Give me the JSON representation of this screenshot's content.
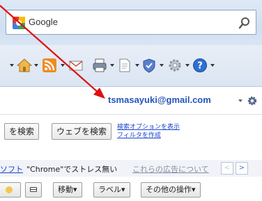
{
  "browser": {
    "search_provider": "Google",
    "icons": [
      "google-provider-icon",
      "search-icon",
      "home-icon",
      "feed-icon",
      "mail-icon",
      "print-icon",
      "page-icon",
      "safety-icon",
      "tools-icon",
      "help-icon"
    ]
  },
  "gmail": {
    "account_email": "tsmasayuki@gmail.com",
    "buttons": {
      "search_mail": "を検索",
      "search_web": "ウェブを検索"
    },
    "links": {
      "search_options": "検索オプションを表示",
      "create_filter": "フィルタを作成"
    },
    "ad": {
      "source": "ソフト",
      "text": "\"Chrome\"でストレス無い",
      "about_ads": "これらの広告について"
    },
    "toolbar": {
      "move": "移動▾",
      "label": "ラベル▾",
      "more": "その他の操作▾"
    }
  },
  "colors": {
    "link": "#1a44cc",
    "account_email": "#2255bb",
    "annotation": "#e01010"
  }
}
